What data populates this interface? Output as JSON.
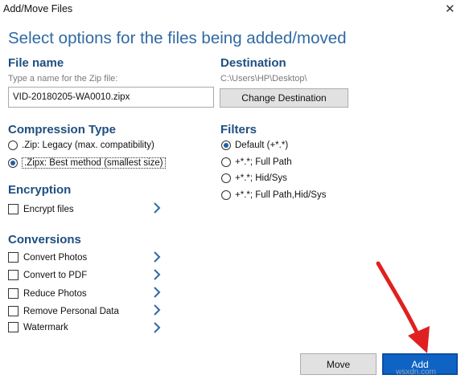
{
  "window": {
    "title": "Add/Move Files",
    "close_glyph": "✕"
  },
  "heading": "Select options for the files being added/moved",
  "file_name": {
    "label": "File name",
    "hint": "Type a name for the Zip file:",
    "value": "VID-20180205-WA0010.zipx"
  },
  "destination": {
    "label": "Destination",
    "path": "C:\\Users\\HP\\Desktop\\",
    "button": "Change Destination"
  },
  "compression": {
    "label": "Compression Type",
    "options": [
      {
        "label": ".Zip: Legacy (max. compatibility)",
        "selected": false
      },
      {
        "label": ".Zipx: Best method (smallest size)",
        "selected": true
      }
    ]
  },
  "filters": {
    "label": "Filters",
    "options": [
      {
        "label": "Default (+*.*)",
        "selected": true
      },
      {
        "label": "+*.*; Full Path",
        "selected": false
      },
      {
        "label": "+*.*; Hid/Sys",
        "selected": false
      },
      {
        "label": "+*.*; Full Path,Hid/Sys",
        "selected": false
      }
    ]
  },
  "encryption": {
    "label": "Encryption",
    "items": [
      {
        "label": "Encrypt files",
        "checked": false,
        "icon": "chevron-right-icon"
      }
    ]
  },
  "conversions": {
    "label": "Conversions",
    "items": [
      {
        "label": "Convert Photos",
        "checked": false,
        "icon": "chevron-right-icon"
      },
      {
        "label": "Convert to PDF",
        "checked": false,
        "icon": "chevron-right-icon"
      },
      {
        "label": "Reduce Photos",
        "checked": false,
        "icon": "chevron-right-icon"
      },
      {
        "label": "Remove Personal Data",
        "checked": false,
        "icon": "chevron-right-icon"
      },
      {
        "label": "Watermark",
        "checked": false,
        "icon": "chevron-right-icon"
      }
    ]
  },
  "buttons": {
    "move": "Move",
    "add": "Add"
  },
  "overlay": {
    "arrow_color": "#e02020",
    "watermark": "wsxdn.com"
  },
  "colors": {
    "heading": "#2f6aa3",
    "section": "#1f4f80",
    "chevron": "#2f6aa3",
    "add_button": "#0f63c4"
  }
}
